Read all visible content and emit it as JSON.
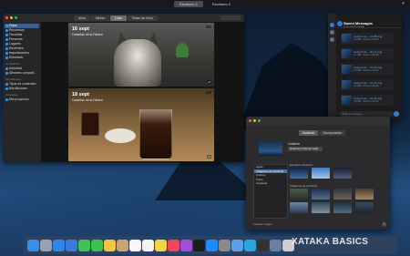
{
  "menubar": {
    "spaces": [
      "Escritorio 1",
      "Escritorio 2"
    ]
  },
  "photos": {
    "tabs": [
      "Años",
      "Meses",
      "Días",
      "Todas las fotos"
    ],
    "sidebar": {
      "library_label": "Fotos",
      "items": [
        "Recuerdos",
        "Favoritas",
        "Personas",
        "Lugares",
        "Recientes",
        "Importaciones",
        "Eliminado"
      ],
      "shared_header": "Compartido",
      "shared_items": [
        "Actividad",
        "Álbumes compart…"
      ],
      "albums_header": "Mis álbumes",
      "album_items": [
        "Tipos de contenido",
        "Mis álbumes"
      ],
      "projects_header": "Proyectos",
      "project_items": [
        "Mis proyectos"
      ]
    },
    "days": [
      {
        "date": "16 sept",
        "place": "Castellar de la Ribera",
        "count": "+4"
      },
      {
        "date": "18 sept",
        "place": "Castellar de la Ribera",
        "count": "+4"
      }
    ],
    "more_label": "···"
  },
  "chat": {
    "title": "Saved Messages",
    "subtitle": "your cloud storage",
    "messages": [
      {
        "file": "Captura de…16.08.png",
        "size": "1.4 MB · Show in Finder"
      },
      {
        "file": "Captura de…20.12.png",
        "size": "1.1 MB · Show in Finder"
      },
      {
        "file": "Captura de…51.03.png",
        "size": "1.3 MB · Show in Finder"
      },
      {
        "file": "Captura de…37.33.png",
        "size": "1.2 MB · Show in Finder"
      },
      {
        "file": "Captura de…12.45.png",
        "size": "0.9 MB · Show in Finder"
      }
    ],
    "input_placeholder": "Write a message…"
  },
  "prefs": {
    "tabs": [
      "Escritorio",
      "Salvapantallas"
    ],
    "wallpaper_name": "Catalina",
    "mode": "Dinámico (Tiempo real)",
    "list": [
      "Apple",
      "Imágenes de escritorio",
      "Colores",
      "Fotos",
      "Carpetas"
    ],
    "dynamic_label": "Escritorio dinámico",
    "images_label": "Imágenes de escritorio",
    "bottom_text": "Cambiar imagen:"
  },
  "dock_icons": [
    "finder-icon",
    "launchpad-icon",
    "safari-icon",
    "mail-icon",
    "messages-icon",
    "facetime-icon",
    "photos-icon",
    "contacts-icon",
    "calendar-icon",
    "reminders-icon",
    "notes-icon",
    "music-icon",
    "podcasts-icon",
    "tv-icon",
    "app-store-icon",
    "system-preferences-icon",
    "preview-icon",
    "telegram-icon",
    "terminal-icon",
    "downloads-icon",
    "trash-icon"
  ],
  "dock_colors": [
    "#3a8ee6",
    "#9aa3ad",
    "#2f86e8",
    "#3b7ad6",
    "#44c155",
    "#3ac152",
    "#f1c442",
    "#c9a27a",
    "#f6f6f6",
    "#f4f4f4",
    "#f0d548",
    "#f0465c",
    "#a24ed8",
    "#1c1c1c",
    "#1f8bff",
    "#8a8a8e",
    "#5da0e8",
    "#2ea4df",
    "#333",
    "#6b7fa3",
    "#cfcfd2"
  ],
  "watermark": "XATAKA BASICS"
}
